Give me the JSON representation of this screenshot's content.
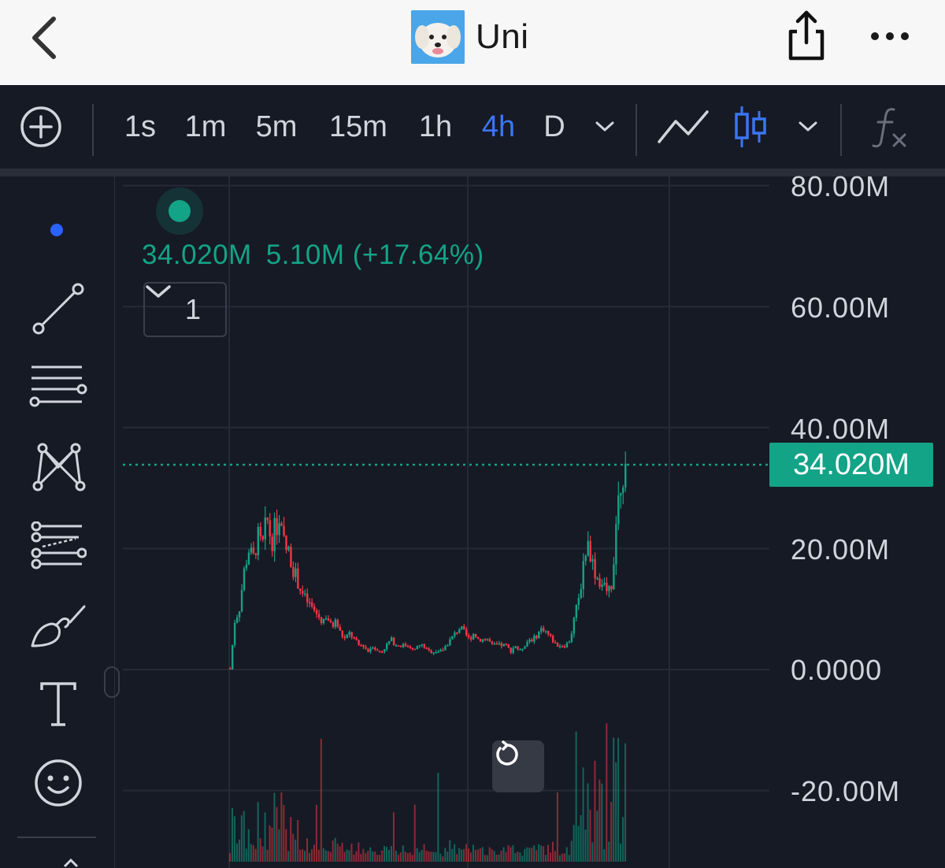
{
  "header": {
    "title": "Uni"
  },
  "toolbar": {
    "intervals": [
      {
        "label": "1s",
        "active": false
      },
      {
        "label": "1m",
        "active": false
      },
      {
        "label": "5m",
        "active": false
      },
      {
        "label": "15m",
        "active": false
      },
      {
        "label": "1h",
        "active": false
      },
      {
        "label": "4h",
        "active": true
      },
      {
        "label": "D",
        "active": false
      }
    ],
    "icons": [
      "add-icon",
      "chevron-down-icon",
      "line-chart-icon",
      "candlestick-chart-icon",
      "chevron-down-icon",
      "function-icon"
    ]
  },
  "drawing_tools": [
    "trend-line-icon",
    "horizontal-lines-icon",
    "pattern-icon",
    "fib-icon",
    "brush-icon",
    "text-icon",
    "emoji-icon"
  ],
  "legend": {
    "price": "34.020M",
    "change": "5.10M (+17.64%)",
    "collapsed_count": "1"
  },
  "price_axis": {
    "labels": [
      "80.00M",
      "60.00M",
      "40.00M",
      "20.00M",
      "0.0000",
      "-20.00M"
    ],
    "current_price": "34.020M"
  },
  "colors": {
    "up": "#13a386",
    "down": "#f23645",
    "accent": "#3a76f2",
    "background": "#161a25"
  },
  "chart_data": {
    "type": "candlestick",
    "interval": "4h",
    "ylim": [
      -20000000,
      80000000
    ],
    "last_price": 34020000,
    "close_series_approx": [
      0,
      8,
      10,
      16,
      20,
      18,
      22,
      20,
      25,
      21,
      24,
      23,
      20,
      19,
      16,
      14,
      12,
      11,
      10,
      9,
      8,
      9,
      7,
      8,
      6,
      5,
      6,
      5,
      4,
      4,
      3,
      4,
      3,
      3,
      4,
      5,
      4,
      4,
      4,
      4,
      3,
      4,
      4,
      3,
      3,
      3,
      3,
      4,
      5,
      6,
      7,
      6,
      5,
      6,
      5,
      5,
      5,
      4,
      4,
      4,
      4,
      3,
      4,
      3,
      4,
      5,
      5,
      6,
      7,
      6,
      5,
      4,
      4,
      4,
      5,
      9,
      12,
      19,
      21,
      17,
      15,
      14,
      13,
      14,
      25,
      32,
      34
    ],
    "close_series_unit": "millions"
  }
}
